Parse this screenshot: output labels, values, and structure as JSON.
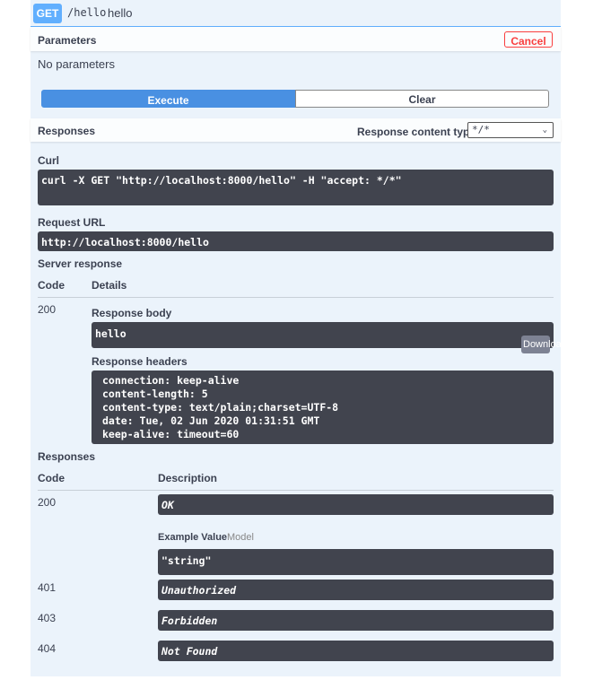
{
  "operation": {
    "method": "GET",
    "path": "/hello",
    "description": "hello"
  },
  "parameters": {
    "title": "Parameters",
    "cancel_label": "Cancel",
    "empty_text": "No parameters"
  },
  "actions": {
    "execute_label": "Execute",
    "clear_label": "Clear"
  },
  "responses_header": {
    "title": "Responses",
    "content_type_label": "Response content type",
    "content_type_value": "*/*"
  },
  "live": {
    "curl_label": "Curl",
    "curl_command": "curl -X GET \"http://localhost:8000/hello\" -H \"accept: */*\"",
    "request_url_label": "Request URL",
    "request_url": "http://localhost:8000/hello",
    "server_response_label": "Server response",
    "col_code": "Code",
    "col_details": "Details",
    "status_code": "200",
    "body_label": "Response body",
    "body_value": "hello",
    "download_label": "Download",
    "headers_label": "Response headers",
    "headers": [
      "connection: keep-alive",
      "content-length: 5",
      "content-type: text/plain;charset=UTF-8",
      "date: Tue, 02 Jun 2020 01:31:51 GMT",
      "keep-alive: timeout=60"
    ]
  },
  "documented": {
    "title": "Responses",
    "col_code": "Code",
    "col_description": "Description",
    "example_value_tab": "Example Value",
    "model_tab": "Model",
    "example_value": "\"string\"",
    "rows": [
      {
        "code": "200",
        "description": "OK"
      },
      {
        "code": "401",
        "description": "Unauthorized"
      },
      {
        "code": "403",
        "description": "Forbidden"
      },
      {
        "code": "404",
        "description": "Not Found"
      }
    ]
  },
  "colors": {
    "get_accent": "#61affe",
    "block_bg": "#ebf3fb",
    "execute_blue": "#4990e2",
    "cancel_red": "#f93e3e",
    "code_bg": "#41444e"
  }
}
